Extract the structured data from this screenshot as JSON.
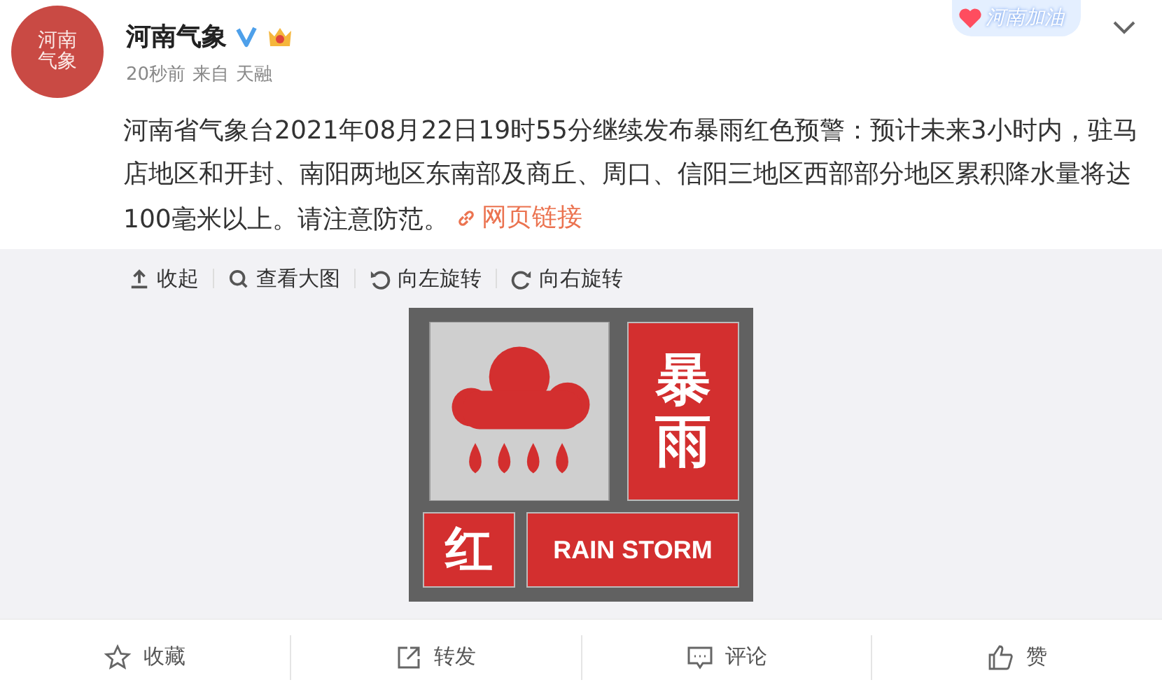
{
  "post": {
    "author": "河南气象",
    "avatar_text": "河南气象",
    "decoration_text": "河南加油",
    "time": "20秒前",
    "source_label": "来自",
    "source": "天融",
    "text": "河南省气象台2021年08月22日19时55分继续发布暴雨红色预警：预计未来3小时内，驻马店地区和开封、南阳两地区东南部及商丘、周口、信阳三地区西部部分地区累积降水量将达100毫米以上。请注意防范。",
    "link": "网页链接"
  },
  "image_toolbar": [
    {
      "kind": "collapse",
      "label": "收起"
    },
    {
      "kind": "zoom",
      "label": "查看大图"
    },
    {
      "kind": "rotate-left",
      "label": "向左旋转"
    },
    {
      "kind": "rotate-right",
      "label": "向右旋转"
    }
  ],
  "warning_sign": {
    "title": "暴雨",
    "level": "红",
    "english": "RAIN STORM"
  },
  "actions": [
    {
      "kind": "favorite",
      "label": "收藏"
    },
    {
      "kind": "repost",
      "label": "转发"
    },
    {
      "kind": "comment",
      "label": "评论"
    },
    {
      "kind": "like",
      "label": "赞"
    }
  ]
}
